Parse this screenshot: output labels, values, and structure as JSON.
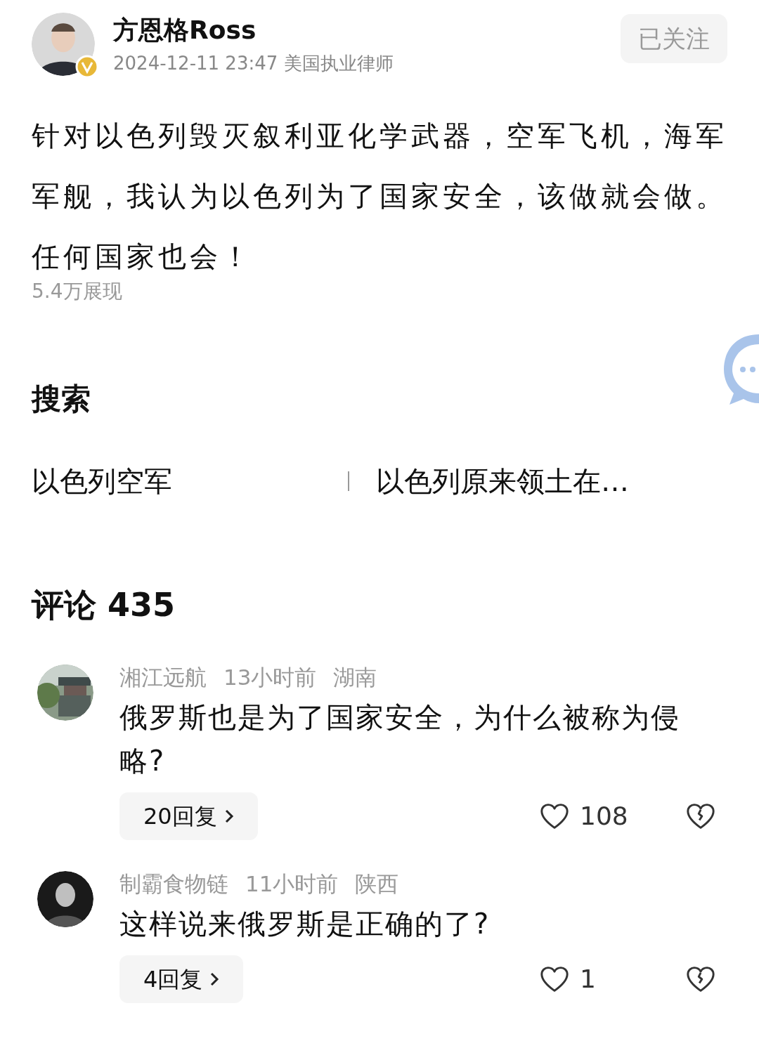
{
  "post": {
    "author": "方恩格Ross",
    "verified": true,
    "meta": "2024-12-11 23:47 美国执业律师",
    "follow_button": "已关注",
    "text": "针对以色列毁灭叙利亚化学武器，空军飞机，海军军舰，我认为以色列为了国家安全，该做就会做。任何国家也会！",
    "views": "5.4万展现"
  },
  "search": {
    "title": "搜索",
    "suggestions": [
      "以色列空军",
      "以色列原来领土在…"
    ]
  },
  "comments_header": "评论 435",
  "comments": [
    {
      "name": "湘江远航",
      "time": "13小时前",
      "region": "湖南",
      "text": "俄罗斯也是为了国家安全，为什么被称为侵略?",
      "replies": "20回复",
      "likes": "108",
      "kind": "building"
    },
    {
      "name": "制霸食物链",
      "time": "11小时前",
      "region": "陕西",
      "text": "这样说来俄罗斯是正确的了?",
      "replies": "4回复",
      "likes": "1",
      "kind": "person"
    }
  ]
}
